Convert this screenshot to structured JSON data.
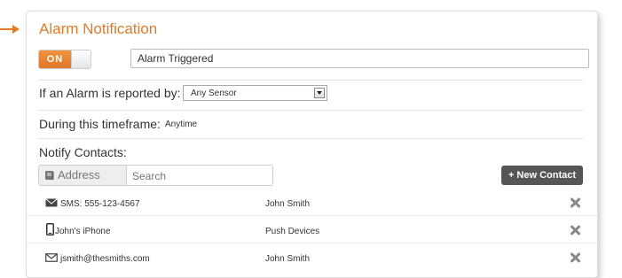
{
  "alarm": {
    "title": "Alarm Notification",
    "toggle_label": "ON",
    "name_value": "Alarm Triggered"
  },
  "reported_by": {
    "label": "If an Alarm is reported by:",
    "selected": "Any Sensor"
  },
  "timeframe": {
    "label": "During this timeframe:",
    "value": "Anytime"
  },
  "notify": {
    "label": "Notify Contacts:",
    "address_book_label": "Address Book",
    "search_placeholder": "Search",
    "new_contact_label": "+ New Contact"
  },
  "contacts": [
    {
      "icon": "envelope-icon",
      "method": "SMS: 555-123-4567",
      "name": "John Smith"
    },
    {
      "icon": "phone-icon",
      "method": "John's iPhone",
      "name": "Push Devices"
    },
    {
      "icon": "envelope-outline-icon",
      "method": "jsmith@thesmiths.com",
      "name": "John Smith"
    }
  ],
  "colors": {
    "accent": "#e07b2a",
    "button_dark": "#555555"
  }
}
